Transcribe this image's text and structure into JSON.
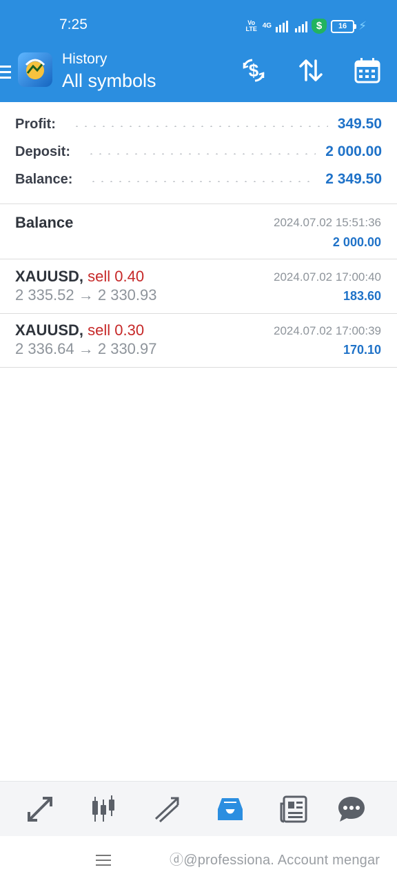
{
  "status_bar": {
    "time": "7:25",
    "volte_label": "Vo LTE",
    "network_label": "4G",
    "battery_level": "16"
  },
  "app_bar": {
    "title": "History",
    "subtitle": "All symbols",
    "icons": [
      "menu-icon",
      "app-logo-icon",
      "dollar-refresh-icon",
      "sort-arrows-icon",
      "calendar-icon"
    ]
  },
  "summary": {
    "profit_label": "Profit:",
    "profit_value": "349.50",
    "deposit_label": "Deposit:",
    "deposit_value": "2 000.00",
    "balance_label": "Balance:",
    "balance_value": "2 349.50"
  },
  "history": [
    {
      "title": "Balance",
      "date": "2024.07.02 15:51:36",
      "amount": "2 000.00"
    },
    {
      "symbol": "XAUUSD,",
      "side": "sell 0.40",
      "prices": "2 335.52 → 2 330.93",
      "date": "2024.07.02 17:00:40",
      "amount": "183.60"
    },
    {
      "symbol": "XAUUSD,",
      "side": "sell 0.30",
      "prices": "2 336.64 → 2 330.97",
      "date": "2024.07.02 17:00:39",
      "amount": "170.10"
    }
  ],
  "bottom_nav": {
    "items": [
      "quotes-icon",
      "chart-icon",
      "trade-icon",
      "history-icon",
      "news-icon",
      "messages-icon"
    ],
    "active": "history-icon",
    "active_color": "#2b8ee0"
  },
  "colors": {
    "accent": "#2b8ee0",
    "value_blue": "#1f72c8",
    "sell_red": "#c62828"
  },
  "watermark": "ⓓ@professiona. Account mengar"
}
